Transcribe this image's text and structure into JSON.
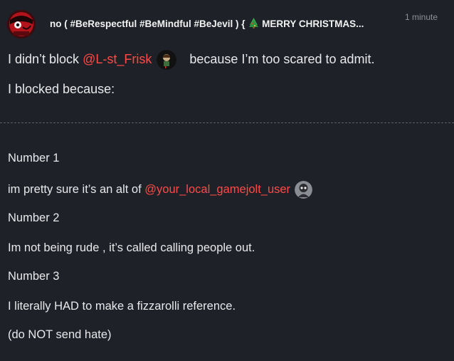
{
  "post": {
    "username": "no ( #BeRespectful #BeMindful #BeJevil ) {",
    "username_suffix": "MERRY CHRISTMAS...",
    "timestamp": "1 minute",
    "avatar_icon": "evil-red-character-avatar-icon",
    "colors": {
      "background": "#1e2128",
      "text": "#e9e9eb",
      "mention": "#ff4a45",
      "timestamp": "#8d9099"
    },
    "line1": {
      "prefix": "I didn’t block ",
      "mention": "@L-st_Frisk",
      "mention_avatar_icon": "frisk-user-avatar-icon",
      "suffix": "because I’m too scared to admit."
    },
    "line2": "I blocked because:",
    "number1_label": "Number 1",
    "number1_text": {
      "prefix": "im pretty sure it’s an alt of ",
      "mention": "@your_local_gamejolt_user",
      "mention_avatar_icon": "gamejolt-user-avatar-icon"
    },
    "number2_label": "Number 2",
    "number2_text": "Im not being rude , it’s called calling people out.",
    "number3_label": "Number 3",
    "number3_text": "I literally HAD to make a fizzarolli reference.",
    "closing_text": "(do NOT send hate)"
  }
}
